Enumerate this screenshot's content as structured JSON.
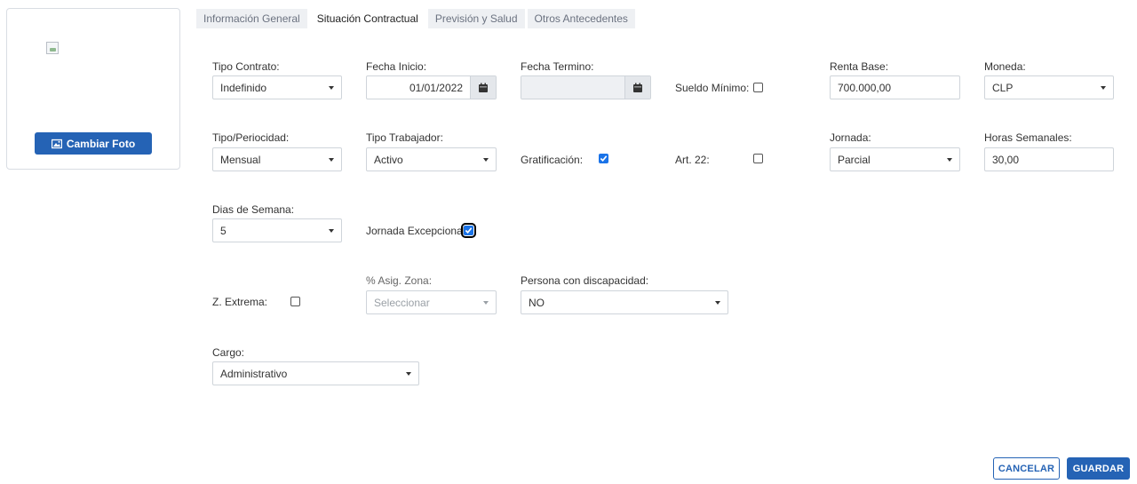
{
  "photo": {
    "change_label": "Cambiar Foto"
  },
  "tabs": [
    {
      "label": "Información General"
    },
    {
      "label": "Situación Contractual"
    },
    {
      "label": "Previsión y Salud"
    },
    {
      "label": "Otros Antecedentes"
    }
  ],
  "form": {
    "tipo_contrato": {
      "label": "Tipo Contrato:",
      "value": "Indefinido"
    },
    "fecha_inicio": {
      "label": "Fecha Inicio:",
      "value": "01/01/2022"
    },
    "fecha_termino": {
      "label": "Fecha Termino:",
      "value": ""
    },
    "sueldo_minimo": {
      "label": "Sueldo Mínimo:",
      "checked": false
    },
    "renta_base": {
      "label": "Renta Base:",
      "value": "700.000,00"
    },
    "moneda": {
      "label": "Moneda:",
      "value": "CLP"
    },
    "tipo_periocidad": {
      "label": "Tipo/Periocidad:",
      "value": "Mensual"
    },
    "tipo_trabajador": {
      "label": "Tipo Trabajador:",
      "value": "Activo"
    },
    "gratificacion": {
      "label": "Gratificación:",
      "checked": true
    },
    "art22": {
      "label": "Art. 22:",
      "checked": false
    },
    "jornada": {
      "label": "Jornada:",
      "value": "Parcial"
    },
    "horas_semanales": {
      "label": "Horas Semanales:",
      "value": "30,00"
    },
    "dias_semana": {
      "label": "Dias de Semana:",
      "value": "5"
    },
    "jornada_excepcional": {
      "label": "Jornada Excepcional:",
      "checked": true
    },
    "z_extrema": {
      "label": "Z. Extrema:",
      "checked": false
    },
    "asig_zona": {
      "label": "% Asig. Zona:",
      "placeholder": "Seleccionar"
    },
    "discapacidad": {
      "label": "Persona con discapacidad:",
      "value": "NO"
    },
    "cargo": {
      "label": "Cargo:",
      "value": "Administrativo"
    }
  },
  "actions": {
    "cancel": "CANCELAR",
    "save": "GUARDAR"
  },
  "colors": {
    "primary": "#2563b5",
    "checkbox": "#1a73e8"
  }
}
